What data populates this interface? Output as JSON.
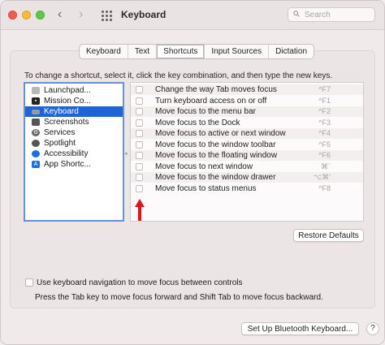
{
  "window": {
    "title": "Keyboard"
  },
  "search": {
    "placeholder": "Search"
  },
  "tabs": [
    {
      "label": "Keyboard"
    },
    {
      "label": "Text"
    },
    {
      "label": "Shortcuts",
      "active": true
    },
    {
      "label": "Input Sources"
    },
    {
      "label": "Dictation"
    }
  ],
  "instructions": "To change a shortcut, select it, click the key combination, and then type the new keys.",
  "categories": [
    {
      "label": "Launchpad...",
      "icon": "launchpad-icon",
      "color": "#b7b7b7"
    },
    {
      "label": "Mission Co...",
      "icon": "mission-control-icon",
      "color": "#222222"
    },
    {
      "label": "Keyboard",
      "icon": "keyboard-icon",
      "color": "#9a9a9a",
      "selected": true
    },
    {
      "label": "Screenshots",
      "icon": "screenshots-icon",
      "color": "#555555"
    },
    {
      "label": "Services",
      "icon": "gear-icon",
      "color": "#666666"
    },
    {
      "label": "Spotlight",
      "icon": "spotlight-icon",
      "color": "#555555"
    },
    {
      "label": "Accessibility",
      "icon": "accessibility-icon",
      "color": "#1d6fe0"
    },
    {
      "label": "App Shortc...",
      "icon": "app-shortcuts-icon",
      "color": "#1d6fe0"
    }
  ],
  "shortcuts": [
    {
      "label": "Change the way Tab moves focus",
      "key": "^F7"
    },
    {
      "label": "Turn keyboard access on or off",
      "key": "^F1"
    },
    {
      "label": "Move focus to the menu bar",
      "key": "^F2"
    },
    {
      "label": "Move focus to the Dock",
      "key": "^F3"
    },
    {
      "label": "Move focus to active or next window",
      "key": "^F4"
    },
    {
      "label": "Move focus to the window toolbar",
      "key": "^F5"
    },
    {
      "label": "Move focus to the floating window",
      "key": "^F6"
    },
    {
      "label": "Move focus to next window",
      "key": "⌘`"
    },
    {
      "label": "Move focus to the window drawer",
      "key": "⌥⌘'"
    },
    {
      "label": "Move focus to status menus",
      "key": "^F8"
    }
  ],
  "buttons": {
    "restore_defaults": "Restore Defaults",
    "bluetooth": "Set Up Bluetooth Keyboard...",
    "help": "?"
  },
  "keyboard_navigation": {
    "label": "Use keyboard navigation to move focus between controls",
    "help": "Press the Tab key to move focus forward and Shift Tab to move focus backward."
  },
  "colors": {
    "selection": "#1e64d8",
    "annotation_arrow": "#e0141c"
  }
}
